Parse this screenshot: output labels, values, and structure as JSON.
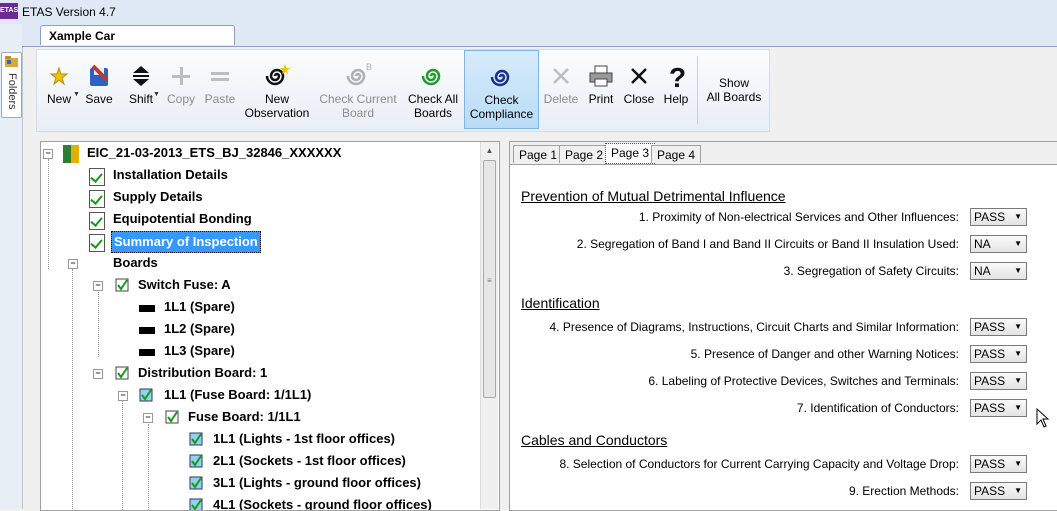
{
  "app": {
    "icon_label": "ETAS",
    "title": "ETAS Version 4.7"
  },
  "sidebar": {
    "folders_label": "Folders"
  },
  "document_tab": {
    "label": "Xample Car Dealership_Xample..."
  },
  "toolbar": {
    "new": "New",
    "save": "Save",
    "shift": "Shift",
    "copy": "Copy",
    "paste": "Paste",
    "new_observation": [
      "New",
      "Observation"
    ],
    "check_current_board": [
      "Check Current",
      "Board"
    ],
    "check_all_boards": [
      "Check All",
      "Boards"
    ],
    "check_compliance": [
      "Check",
      "Compliance"
    ],
    "delete": "Delete",
    "print": "Print",
    "close": "Close",
    "help": "Help",
    "show_all_boards": [
      "Show",
      "All Boards"
    ]
  },
  "tree": {
    "root": "EIC_21-03-2013_ETS_BJ_32846_XXXXXX",
    "installation_details": "Installation Details",
    "supply_details": "Supply Details",
    "equipotential_bonding": "Equipotential Bonding",
    "summary_of_inspection": "Summary of Inspection",
    "boards": "Boards",
    "switch_fuse": "Switch Fuse: A",
    "spare1": "1L1 (Spare)",
    "spare2": "1L2 (Spare)",
    "spare3": "1L3 (Spare)",
    "distribution_board": "Distribution Board: 1",
    "fuse_circuit": "1L1 (Fuse Board: 1/1L1)",
    "fuse_board": "Fuse Board: 1/1L1",
    "c1": "1L1 (Lights - 1st floor offices)",
    "c2": "2L1 (Sockets - 1st floor offices)",
    "c3": "3L1 (Lights - ground floor offices)",
    "c4": "4L1 (Sockets - ground floor offices)"
  },
  "pages": {
    "tabs": [
      "Page 1",
      "Page 2",
      "Page 3",
      "Page 4"
    ],
    "active": "Page 3"
  },
  "sections": {
    "s1": "Prevention of Mutual Detrimental Influence",
    "s2": "Identification",
    "s3": "Cables and Conductors"
  },
  "questions": {
    "q1": {
      "text": "1. Proximity of Non-electrical Services and Other Influences:",
      "value": "PASS"
    },
    "q2": {
      "text": "2. Segregation of Band I and Band II Circuits or Band II Insulation Used:",
      "value": "NA"
    },
    "q3": {
      "text": "3. Segregation of Safety Circuits:",
      "value": "NA"
    },
    "q4": {
      "text": "4. Presence of Diagrams, Instructions, Circuit Charts and Similar Information:",
      "value": "PASS"
    },
    "q5": {
      "text": "5. Presence of Danger and other Warning Notices:",
      "value": "PASS"
    },
    "q6": {
      "text": "6. Labeling of Protective Devices, Switches and Terminals:",
      "value": "PASS"
    },
    "q7": {
      "text": "7. Identification of Conductors:",
      "value": "PASS"
    },
    "q8": {
      "text": "8. Selection of Conductors for Current Carrying Capacity and Voltage Drop:",
      "value": "PASS"
    },
    "q9": {
      "text": "9. Erection Methods:",
      "value": "PASS"
    }
  },
  "colors": {
    "selection": "#3399ff",
    "accent": "#6a2c91",
    "check": "#1a9a1a"
  }
}
